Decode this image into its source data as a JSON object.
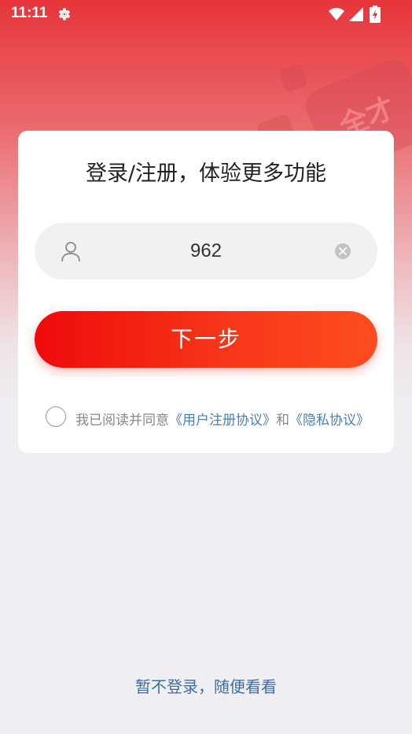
{
  "status_bar": {
    "time": "11:11",
    "icons": [
      "gear-icon",
      "wifi-icon",
      "signal-icon",
      "battery-charging-icon"
    ]
  },
  "decoration": {
    "watermark_text": "全才"
  },
  "card": {
    "title": "登录/注册，体验更多功能",
    "phone_input": {
      "value": "962",
      "icon": "user-icon",
      "clear_icon": "clear-icon"
    },
    "next_button": "下一步",
    "agreement": {
      "prefix": "我已阅读并同意",
      "user_agreement": "《用户注册协议》",
      "conjunction": "和",
      "privacy_policy": "《隐私协议》",
      "checked": false
    }
  },
  "skip_link": "暂不登录，随便看看",
  "colors": {
    "brand_red": "#ef0a0a",
    "brand_orange": "#fe4d1e",
    "link_blue": "#4a7fb6",
    "background": "#efeef3"
  }
}
